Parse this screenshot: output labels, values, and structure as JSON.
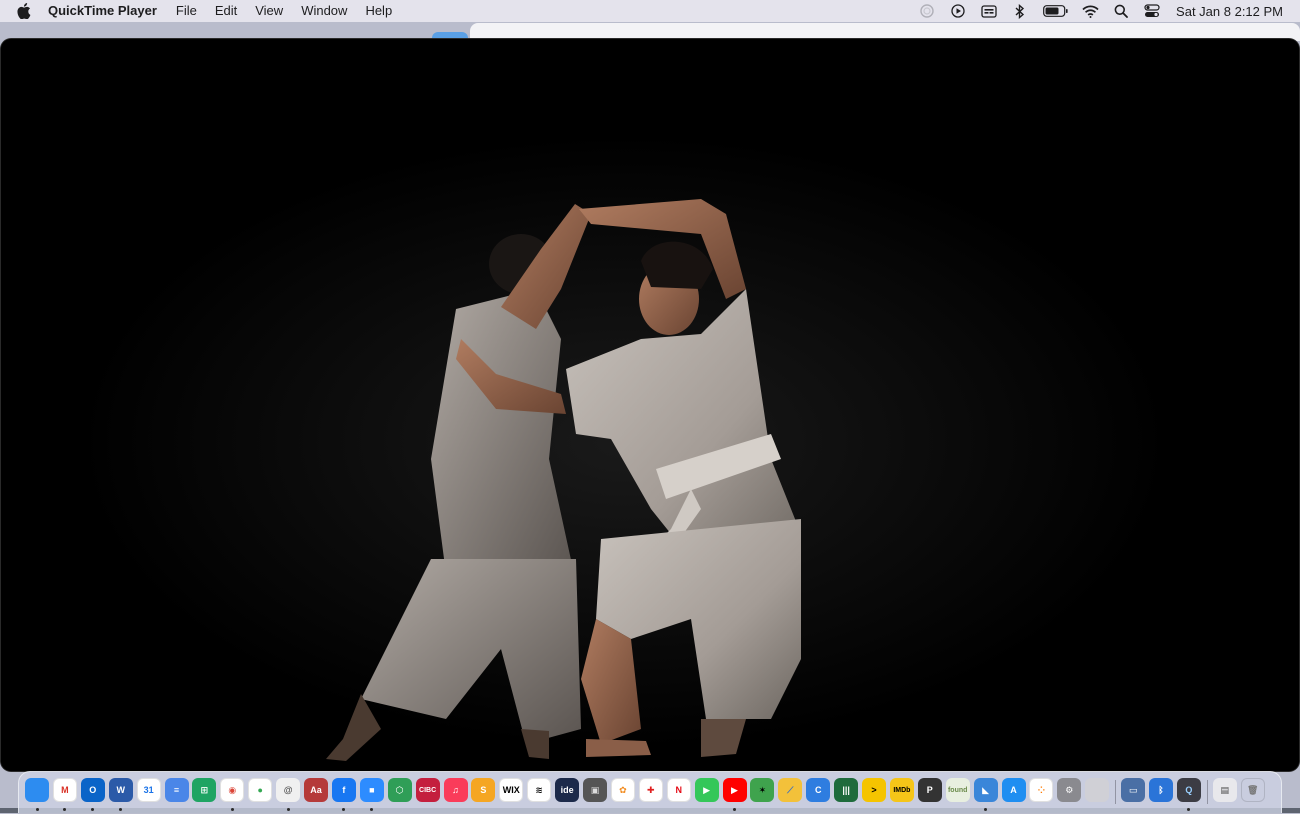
{
  "menubar": {
    "app_name": "QuickTime Player",
    "menus": [
      "File",
      "Edit",
      "View",
      "Window",
      "Help"
    ],
    "status_icons": [
      "siri-icon",
      "play-icon",
      "caption-icon",
      "bluetooth-icon",
      "battery-icon",
      "wifi-icon",
      "search-icon",
      "control-center-icon"
    ],
    "clock": "Sat Jan 8  2:12 PM"
  },
  "player": {
    "content": "video-frame"
  },
  "dock": {
    "apps": [
      {
        "name": "finder-icon",
        "label": "",
        "bg": "#2d8cf0",
        "fg": "#ffffff",
        "running": true
      },
      {
        "name": "gmail-icon",
        "label": "M",
        "bg": "#ffffff",
        "fg": "#d93025",
        "running": true
      },
      {
        "name": "outlook-icon",
        "label": "O",
        "bg": "#0a64c8",
        "fg": "#ffffff",
        "running": true
      },
      {
        "name": "word-icon",
        "label": "W",
        "bg": "#2b5aa8",
        "fg": "#ffffff",
        "running": true
      },
      {
        "name": "google-calendar-icon",
        "label": "31",
        "bg": "#ffffff",
        "fg": "#1a73e8",
        "running": false
      },
      {
        "name": "google-docs-icon",
        "label": "≡",
        "bg": "#4a86e8",
        "fg": "#ffffff",
        "running": false
      },
      {
        "name": "google-sheets-icon",
        "label": "⊞",
        "bg": "#1fa463",
        "fg": "#ffffff",
        "running": false
      },
      {
        "name": "chrome-icon",
        "label": "◉",
        "bg": "#ffffff",
        "fg": "#db4437",
        "running": true
      },
      {
        "name": "google-maps-icon",
        "label": "●",
        "bg": "#ffffff",
        "fg": "#34a853",
        "running": false
      },
      {
        "name": "spiral-app-icon",
        "label": "@",
        "bg": "#f0f0f0",
        "fg": "#555555",
        "running": true
      },
      {
        "name": "dictionary-icon",
        "label": "Aa",
        "bg": "#b53a3a",
        "fg": "#ffffff",
        "running": false
      },
      {
        "name": "facebook-icon",
        "label": "f",
        "bg": "#1877f2",
        "fg": "#ffffff",
        "running": true
      },
      {
        "name": "zoom-icon",
        "label": "■",
        "bg": "#2d8cff",
        "fg": "#ffffff",
        "running": true
      },
      {
        "name": "hexagon-app-icon",
        "label": "⬡",
        "bg": "#2f9e57",
        "fg": "#ffffff",
        "running": false
      },
      {
        "name": "cibc-icon",
        "label": "CIBC",
        "bg": "#c41f3e",
        "fg": "#ffffff",
        "running": false
      },
      {
        "name": "music-icon",
        "label": "♫",
        "bg": "#fa3c5a",
        "fg": "#ffffff",
        "running": false
      },
      {
        "name": "slides-app-icon",
        "label": "S",
        "bg": "#f5a623",
        "fg": "#ffffff",
        "running": false
      },
      {
        "name": "wix-icon",
        "label": "WIX",
        "bg": "#ffffff",
        "fg": "#000000",
        "running": false
      },
      {
        "name": "squarespace-icon",
        "label": "≋",
        "bg": "#ffffff",
        "fg": "#111111",
        "running": false
      },
      {
        "name": "ide-icon",
        "label": "ide",
        "bg": "#1c2a4a",
        "fg": "#ffffff",
        "running": false
      },
      {
        "name": "cube-app-icon",
        "label": "▣",
        "bg": "#555555",
        "fg": "#dddddd",
        "running": false
      },
      {
        "name": "photos-icon",
        "label": "✿",
        "bg": "#ffffff",
        "fg": "#f28b1e",
        "running": false
      },
      {
        "name": "first-aid-icon",
        "label": "✚",
        "bg": "#ffffff",
        "fg": "#e02020",
        "running": false
      },
      {
        "name": "netflix-icon",
        "label": "N",
        "bg": "#ffffff",
        "fg": "#e50914",
        "running": false
      },
      {
        "name": "facetime-icon",
        "label": "▶",
        "bg": "#34c759",
        "fg": "#ffffff",
        "running": false
      },
      {
        "name": "youtube-icon",
        "label": "▶",
        "bg": "#ff0000",
        "fg": "#ffffff",
        "running": true
      },
      {
        "name": "dance-app-icon",
        "label": "✶",
        "bg": "#3fa34d",
        "fg": "#000000",
        "running": false
      },
      {
        "name": "sketch-app-icon",
        "label": "⟋",
        "bg": "#f3c13a",
        "fg": "#3b6fc4",
        "running": false
      },
      {
        "name": "c-app-icon",
        "label": "C",
        "bg": "#2e7de0",
        "fg": "#ffffff",
        "running": false
      },
      {
        "name": "bars-app-icon",
        "label": "|||",
        "bg": "#1e6b3c",
        "fg": "#ffffff",
        "running": false
      },
      {
        "name": "prompt-app-icon",
        "label": ">",
        "bg": "#f5c400",
        "fg": "#000000",
        "running": false
      },
      {
        "name": "imdb-icon",
        "label": "IMDb",
        "bg": "#f5c518",
        "fg": "#000000",
        "running": false
      },
      {
        "name": "p-app-icon",
        "label": "P",
        "bg": "#333333",
        "fg": "#ffffff",
        "running": false
      },
      {
        "name": "found-app-icon",
        "label": "found",
        "bg": "#e8efe0",
        "fg": "#6a8a4a",
        "running": false
      },
      {
        "name": "folder-blue-icon",
        "label": "◣",
        "bg": "#3a86d9",
        "fg": "#ffffff",
        "running": true
      },
      {
        "name": "app-store-icon",
        "label": "A",
        "bg": "#1f8ef1",
        "fg": "#ffffff",
        "running": false
      },
      {
        "name": "launchpad-icon",
        "label": "⁘",
        "bg": "#ffffff",
        "fg": "#ff7a00",
        "running": false
      },
      {
        "name": "system-preferences-icon",
        "label": "⚙",
        "bg": "#8a8a8f",
        "fg": "#ffffff",
        "running": false
      },
      {
        "name": "apple-app-icon",
        "label": "",
        "bg": "#d0d0d6",
        "fg": "#9a9aa2",
        "running": false
      }
    ],
    "utilities": [
      {
        "name": "screen-sharing-icon",
        "label": "▭",
        "bg": "#4a6fa5",
        "fg": "#ffffff",
        "running": false
      },
      {
        "name": "bluetooth-exchange-icon",
        "label": "ᛒ",
        "bg": "#2a74d8",
        "fg": "#ffffff",
        "running": false
      },
      {
        "name": "quicktime-icon",
        "label": "Q",
        "bg": "#3c3c44",
        "fg": "#9ad0ff",
        "running": true
      }
    ],
    "trash_area": [
      {
        "name": "preview-window-icon",
        "label": "▤",
        "bg": "#e8e8ec",
        "fg": "#444444",
        "running": false
      },
      {
        "name": "trash-icon",
        "label": "🗑",
        "bg": "transparent",
        "fg": "#777777",
        "running": false
      }
    ]
  }
}
